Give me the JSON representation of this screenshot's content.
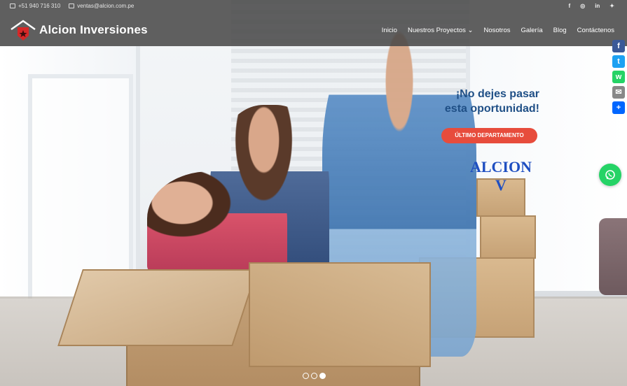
{
  "topbar": {
    "phone": "+51 940 716 310",
    "email": "ventas@alcion.com.pe",
    "social": [
      {
        "icon": "facebook-icon",
        "glyph": "f"
      },
      {
        "icon": "instagram-icon",
        "glyph": "◎"
      },
      {
        "icon": "linkedin-icon",
        "glyph": "in"
      },
      {
        "icon": "twitter-icon",
        "glyph": "✦"
      }
    ]
  },
  "brand": {
    "name": "Alcion Inversiones",
    "mark_color": "#d62828"
  },
  "nav": {
    "items": [
      "Inicio",
      "Nuestros Proyectos",
      "Nosotros",
      "Galería",
      "Blog",
      "Contáctenos"
    ]
  },
  "hero": {
    "headline_1": "¡No dejes pasar",
    "headline_2": "esta oportunidad!",
    "cta_label": "ÚLTIMO DEPARTAMENTO",
    "project_name_1": "ALCION",
    "project_name_2": "V",
    "headline_color": "#1f4f86",
    "cta_color": "#e74c3c"
  },
  "share_buttons": [
    {
      "icon": "facebook-share-icon",
      "glyph": "f",
      "color": "#3b5998"
    },
    {
      "icon": "twitter-share-icon",
      "glyph": "t",
      "color": "#1da1f2"
    },
    {
      "icon": "whatsapp-share-icon",
      "glyph": "w",
      "color": "#25d366"
    },
    {
      "icon": "email-share-icon",
      "glyph": "✉",
      "color": "#888888"
    },
    {
      "icon": "more-share-icon",
      "glyph": "+",
      "color": "#0166ff"
    }
  ],
  "slider": {
    "count": 3,
    "active_index": 2
  }
}
